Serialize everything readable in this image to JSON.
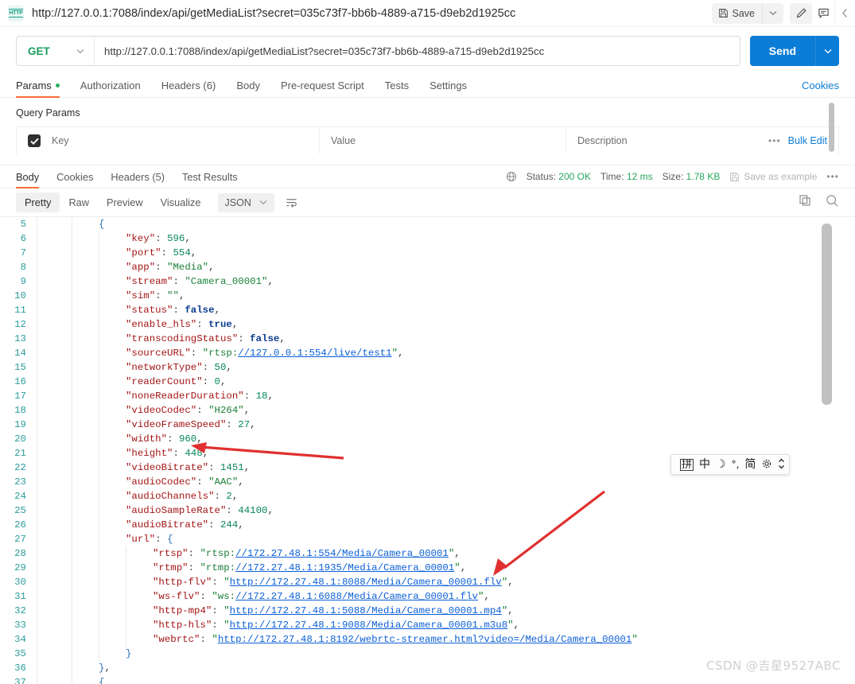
{
  "topbar": {
    "protocol_badge": "HTTP",
    "request_title": "http://127.0.0.1:7088/index/api/getMediaList?secret=035c73f7-bb6b-4889-a715-d9eb2d1925cc",
    "save_label": "Save",
    "icons": [
      "save-icon",
      "chevron-down-icon",
      "pencil-icon",
      "comment-icon",
      "chevron-left-icon"
    ]
  },
  "request": {
    "method": "GET",
    "url": "http://127.0.0.1:7088/index/api/getMediaList?secret=035c73f7-bb6b-4889-a715-d9eb2d1925cc",
    "send_label": "Send"
  },
  "request_tabs": [
    {
      "label": "Params",
      "active": true,
      "dot": true
    },
    {
      "label": "Authorization",
      "active": false,
      "dot": false
    },
    {
      "label": "Headers (6)",
      "active": false,
      "dot": false
    },
    {
      "label": "Body",
      "active": false,
      "dot": false
    },
    {
      "label": "Pre-request Script",
      "active": false,
      "dot": false
    },
    {
      "label": "Tests",
      "active": false,
      "dot": false
    },
    {
      "label": "Settings",
      "active": false,
      "dot": false
    }
  ],
  "cookies_link": "Cookies",
  "query_params": {
    "section_label": "Query Params",
    "columns": [
      "Key",
      "Value",
      "Description"
    ],
    "bulk_edit_label": "Bulk Edit",
    "more_dots": "•••",
    "rows": []
  },
  "response": {
    "tabs": [
      {
        "label": "Body",
        "active": true
      },
      {
        "label": "Cookies",
        "active": false
      },
      {
        "label": "Headers (5)",
        "active": false
      },
      {
        "label": "Test Results",
        "active": false
      }
    ],
    "status_label": "Status:",
    "status_value": "200 OK",
    "time_label": "Time:",
    "time_value": "12 ms",
    "size_label": "Size:",
    "size_value": "1.78 KB",
    "save_as_example": "Save as example",
    "more_dots": "•••",
    "view_modes": [
      {
        "label": "Pretty",
        "active": true
      },
      {
        "label": "Raw",
        "active": false
      },
      {
        "label": "Preview",
        "active": false
      },
      {
        "label": "Visualize",
        "active": false
      }
    ],
    "format": "JSON",
    "right_icons": [
      "copy-icon",
      "search-icon"
    ]
  },
  "code_lines": [
    {
      "num": "",
      "indent": 0,
      "clipped": true,
      "tokens": []
    },
    {
      "num": "5",
      "indent": 2,
      "tokens": [
        {
          "t": "brace",
          "v": "{"
        }
      ]
    },
    {
      "num": "6",
      "indent": 3,
      "tokens": [
        {
          "t": "k",
          "v": "\"key\""
        },
        {
          "t": "p",
          "v": ": "
        },
        {
          "t": "n",
          "v": "596"
        },
        {
          "t": "p",
          "v": ","
        }
      ]
    },
    {
      "num": "7",
      "indent": 3,
      "tokens": [
        {
          "t": "k",
          "v": "\"port\""
        },
        {
          "t": "p",
          "v": ": "
        },
        {
          "t": "n",
          "v": "554"
        },
        {
          "t": "p",
          "v": ","
        }
      ]
    },
    {
      "num": "8",
      "indent": 3,
      "tokens": [
        {
          "t": "k",
          "v": "\"app\""
        },
        {
          "t": "p",
          "v": ": "
        },
        {
          "t": "s",
          "v": "\"Media\""
        },
        {
          "t": "p",
          "v": ","
        }
      ]
    },
    {
      "num": "9",
      "indent": 3,
      "tokens": [
        {
          "t": "k",
          "v": "\"stream\""
        },
        {
          "t": "p",
          "v": ": "
        },
        {
          "t": "s",
          "v": "\"Camera_00001\""
        },
        {
          "t": "p",
          "v": ","
        }
      ]
    },
    {
      "num": "10",
      "indent": 3,
      "tokens": [
        {
          "t": "k",
          "v": "\"sim\""
        },
        {
          "t": "p",
          "v": ": "
        },
        {
          "t": "s",
          "v": "\"\""
        },
        {
          "t": "p",
          "v": ","
        }
      ]
    },
    {
      "num": "11",
      "indent": 3,
      "tokens": [
        {
          "t": "k",
          "v": "\"status\""
        },
        {
          "t": "p",
          "v": ": "
        },
        {
          "t": "b",
          "v": "false"
        },
        {
          "t": "p",
          "v": ","
        }
      ]
    },
    {
      "num": "12",
      "indent": 3,
      "tokens": [
        {
          "t": "k",
          "v": "\"enable_hls\""
        },
        {
          "t": "p",
          "v": ": "
        },
        {
          "t": "b",
          "v": "true"
        },
        {
          "t": "p",
          "v": ","
        }
      ]
    },
    {
      "num": "13",
      "indent": 3,
      "tokens": [
        {
          "t": "k",
          "v": "\"transcodingStatus\""
        },
        {
          "t": "p",
          "v": ": "
        },
        {
          "t": "b",
          "v": "false"
        },
        {
          "t": "p",
          "v": ","
        }
      ]
    },
    {
      "num": "14",
      "indent": 3,
      "tokens": [
        {
          "t": "k",
          "v": "\"sourceURL\""
        },
        {
          "t": "p",
          "v": ": "
        },
        {
          "t": "s",
          "v": "\"rtsp:"
        },
        {
          "t": "lnk",
          "v": "//127.0.0.1:554/live/test1"
        },
        {
          "t": "s",
          "v": "\""
        },
        {
          "t": "p",
          "v": ","
        }
      ]
    },
    {
      "num": "15",
      "indent": 3,
      "tokens": [
        {
          "t": "k",
          "v": "\"networkType\""
        },
        {
          "t": "p",
          "v": ": "
        },
        {
          "t": "n",
          "v": "50"
        },
        {
          "t": "p",
          "v": ","
        }
      ]
    },
    {
      "num": "16",
      "indent": 3,
      "tokens": [
        {
          "t": "k",
          "v": "\"readerCount\""
        },
        {
          "t": "p",
          "v": ": "
        },
        {
          "t": "n",
          "v": "0"
        },
        {
          "t": "p",
          "v": ","
        }
      ]
    },
    {
      "num": "17",
      "indent": 3,
      "tokens": [
        {
          "t": "k",
          "v": "\"noneReaderDuration\""
        },
        {
          "t": "p",
          "v": ": "
        },
        {
          "t": "n",
          "v": "18"
        },
        {
          "t": "p",
          "v": ","
        }
      ]
    },
    {
      "num": "18",
      "indent": 3,
      "tokens": [
        {
          "t": "k",
          "v": "\"videoCodec\""
        },
        {
          "t": "p",
          "v": ": "
        },
        {
          "t": "s",
          "v": "\"H264\""
        },
        {
          "t": "p",
          "v": ","
        }
      ]
    },
    {
      "num": "19",
      "indent": 3,
      "tokens": [
        {
          "t": "k",
          "v": "\"videoFrameSpeed\""
        },
        {
          "t": "p",
          "v": ": "
        },
        {
          "t": "n",
          "v": "27"
        },
        {
          "t": "p",
          "v": ","
        }
      ]
    },
    {
      "num": "20",
      "indent": 3,
      "tokens": [
        {
          "t": "k",
          "v": "\"width\""
        },
        {
          "t": "p",
          "v": ": "
        },
        {
          "t": "n",
          "v": "960"
        },
        {
          "t": "p",
          "v": ","
        }
      ]
    },
    {
      "num": "21",
      "indent": 3,
      "tokens": [
        {
          "t": "k",
          "v": "\"height\""
        },
        {
          "t": "p",
          "v": ": "
        },
        {
          "t": "n",
          "v": "448"
        },
        {
          "t": "p",
          "v": ","
        }
      ]
    },
    {
      "num": "22",
      "indent": 3,
      "tokens": [
        {
          "t": "k",
          "v": "\"videoBitrate\""
        },
        {
          "t": "p",
          "v": ": "
        },
        {
          "t": "n",
          "v": "1451"
        },
        {
          "t": "p",
          "v": ","
        }
      ]
    },
    {
      "num": "23",
      "indent": 3,
      "tokens": [
        {
          "t": "k",
          "v": "\"audioCodec\""
        },
        {
          "t": "p",
          "v": ": "
        },
        {
          "t": "s",
          "v": "\"AAC\""
        },
        {
          "t": "p",
          "v": ","
        }
      ]
    },
    {
      "num": "24",
      "indent": 3,
      "tokens": [
        {
          "t": "k",
          "v": "\"audioChannels\""
        },
        {
          "t": "p",
          "v": ": "
        },
        {
          "t": "n",
          "v": "2"
        },
        {
          "t": "p",
          "v": ","
        }
      ]
    },
    {
      "num": "25",
      "indent": 3,
      "tokens": [
        {
          "t": "k",
          "v": "\"audioSampleRate\""
        },
        {
          "t": "p",
          "v": ": "
        },
        {
          "t": "n",
          "v": "44100"
        },
        {
          "t": "p",
          "v": ","
        }
      ]
    },
    {
      "num": "26",
      "indent": 3,
      "tokens": [
        {
          "t": "k",
          "v": "\"audioBitrate\""
        },
        {
          "t": "p",
          "v": ": "
        },
        {
          "t": "n",
          "v": "244"
        },
        {
          "t": "p",
          "v": ","
        }
      ]
    },
    {
      "num": "27",
      "indent": 3,
      "tokens": [
        {
          "t": "k",
          "v": "\"url\""
        },
        {
          "t": "p",
          "v": ": "
        },
        {
          "t": "brace",
          "v": "{"
        }
      ]
    },
    {
      "num": "28",
      "indent": 4,
      "tokens": [
        {
          "t": "k",
          "v": "\"rtsp\""
        },
        {
          "t": "p",
          "v": ": "
        },
        {
          "t": "s",
          "v": "\"rtsp:"
        },
        {
          "t": "lnk",
          "v": "//172.27.48.1:554/Media/Camera_00001"
        },
        {
          "t": "s",
          "v": "\""
        },
        {
          "t": "p",
          "v": ","
        }
      ]
    },
    {
      "num": "29",
      "indent": 4,
      "tokens": [
        {
          "t": "k",
          "v": "\"rtmp\""
        },
        {
          "t": "p",
          "v": ": "
        },
        {
          "t": "s",
          "v": "\"rtmp:"
        },
        {
          "t": "lnk",
          "v": "//172.27.48.1:1935/Media/Camera_00001"
        },
        {
          "t": "s",
          "v": "\""
        },
        {
          "t": "p",
          "v": ","
        }
      ]
    },
    {
      "num": "30",
      "indent": 4,
      "tokens": [
        {
          "t": "k",
          "v": "\"http-flv\""
        },
        {
          "t": "p",
          "v": ": "
        },
        {
          "t": "s",
          "v": "\""
        },
        {
          "t": "lnk",
          "v": "http://172.27.48.1:8088/Media/Camera_00001.flv"
        },
        {
          "t": "s",
          "v": "\""
        },
        {
          "t": "p",
          "v": ","
        }
      ]
    },
    {
      "num": "31",
      "indent": 4,
      "tokens": [
        {
          "t": "k",
          "v": "\"ws-flv\""
        },
        {
          "t": "p",
          "v": ": "
        },
        {
          "t": "s",
          "v": "\"ws:"
        },
        {
          "t": "lnk",
          "v": "//172.27.48.1:6088/Media/Camera_00001.flv"
        },
        {
          "t": "s",
          "v": "\""
        },
        {
          "t": "p",
          "v": ","
        }
      ]
    },
    {
      "num": "32",
      "indent": 4,
      "tokens": [
        {
          "t": "k",
          "v": "\"http-mp4\""
        },
        {
          "t": "p",
          "v": ": "
        },
        {
          "t": "s",
          "v": "\""
        },
        {
          "t": "lnk",
          "v": "http://172.27.48.1:5088/Media/Camera_00001.mp4"
        },
        {
          "t": "s",
          "v": "\""
        },
        {
          "t": "p",
          "v": ","
        }
      ]
    },
    {
      "num": "33",
      "indent": 4,
      "tokens": [
        {
          "t": "k",
          "v": "\"http-hls\""
        },
        {
          "t": "p",
          "v": ": "
        },
        {
          "t": "s",
          "v": "\""
        },
        {
          "t": "lnk",
          "v": "http://172.27.48.1:9088/Media/Camera_00001.m3u8"
        },
        {
          "t": "s",
          "v": "\""
        },
        {
          "t": "p",
          "v": ","
        }
      ]
    },
    {
      "num": "34",
      "indent": 4,
      "tokens": [
        {
          "t": "k",
          "v": "\"webrtc\""
        },
        {
          "t": "p",
          "v": ": "
        },
        {
          "t": "s",
          "v": "\""
        },
        {
          "t": "lnk",
          "v": "http://172.27.48.1:8192/webrtc-streamer.html?video=/Media/Camera_00001"
        },
        {
          "t": "s",
          "v": "\""
        }
      ]
    },
    {
      "num": "35",
      "indent": 3,
      "tokens": [
        {
          "t": "brace",
          "v": "}"
        }
      ]
    },
    {
      "num": "36",
      "indent": 2,
      "tokens": [
        {
          "t": "brace",
          "v": "}"
        },
        {
          "t": "p",
          "v": ","
        }
      ]
    },
    {
      "num": "37",
      "indent": 2,
      "clipped_bottom": true,
      "tokens": [
        {
          "t": "brace",
          "v": "{"
        }
      ]
    }
  ],
  "ime_toolbar": {
    "items": [
      "拼",
      "中",
      "☽",
      "°,",
      "简",
      "gear-icon",
      "more-icon"
    ]
  },
  "watermark": "CSDN @吉星9527ABC",
  "colors": {
    "accent_orange": "#ff6c37",
    "link_blue": "#0b7dd6",
    "send_blue": "#0b7dd6",
    "status_green": "#26a65b",
    "method_green": "#1a9e5c",
    "arrow_red": "#e03030",
    "line_number_teal": "#2d9c9c"
  }
}
